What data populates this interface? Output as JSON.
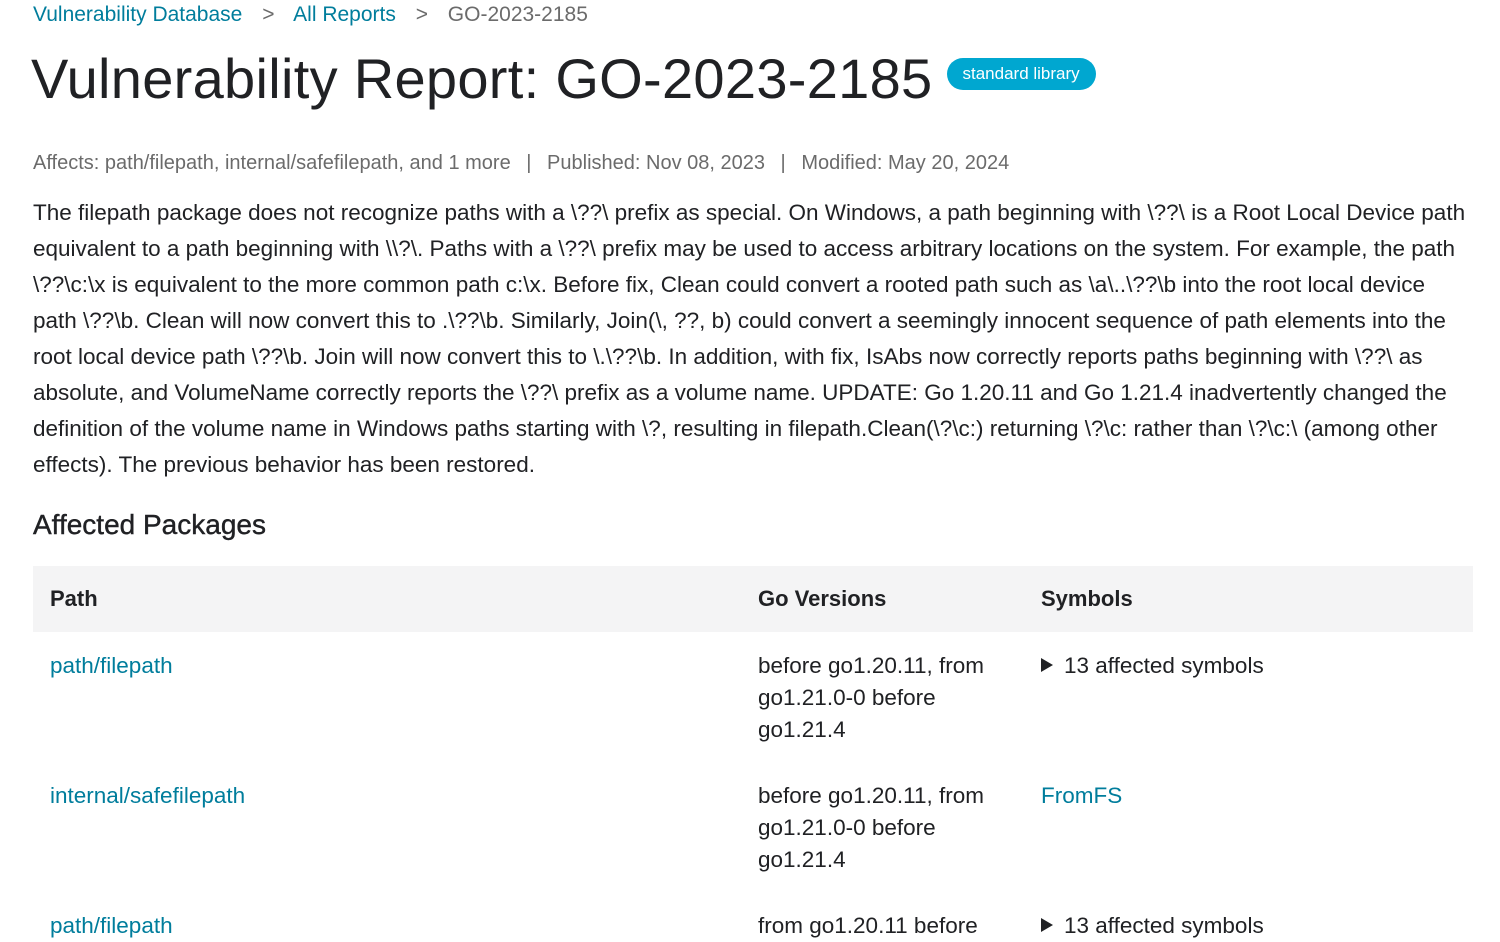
{
  "breadcrumb": {
    "items": [
      {
        "label": "Vulnerability Database"
      },
      {
        "label": "All Reports"
      }
    ],
    "separator": ">",
    "current": "GO-2023-2185"
  },
  "report": {
    "title": "Vulnerability Report: GO-2023-2185",
    "badge": "standard library",
    "affects": "Affects: path/filepath, internal/safefilepath, and 1 more",
    "published": "Published: Nov 08, 2023",
    "modified": "Modified: May 20, 2024",
    "meta_separator": "|",
    "description": "The filepath package does not recognize paths with a \\??\\ prefix as special. On Windows, a path beginning with \\??\\ is a Root Local Device path equivalent to a path beginning with \\\\?\\. Paths with a \\??\\ prefix may be used to access arbitrary locations on the system. For example, the path \\??\\c:\\x is equivalent to the more common path c:\\x. Before fix, Clean could convert a rooted path such as \\a\\..\\??\\b into the root local device path \\??\\b. Clean will now convert this to .\\??\\b. Similarly, Join(\\, ??, b) could convert a seemingly innocent sequence of path elements into the root local device path \\??\\b. Join will now convert this to \\.\\??\\b. In addition, with fix, IsAbs now correctly reports paths beginning with \\??\\ as absolute, and VolumeName correctly reports the \\??\\ prefix as a volume name. UPDATE: Go 1.20.11 and Go 1.21.4 inadvertently changed the definition of the volume name in Windows paths starting with \\?, resulting in filepath.Clean(\\?\\c:) returning \\?\\c: rather than \\?\\c:\\ (among other effects). The previous behavior has been restored."
  },
  "affected_packages": {
    "heading": "Affected Packages",
    "columns": {
      "path": "Path",
      "versions": "Go Versions",
      "symbols": "Symbols"
    },
    "rows": [
      {
        "path": "path/filepath",
        "versions": "before go1.20.11, from go1.21.0-0 before go1.21.4",
        "symbols": "13 affected symbols",
        "symbols_type": "disclosure"
      },
      {
        "path": "internal/safefilepath",
        "versions": "before go1.20.11, from go1.21.0-0 before go1.21.4",
        "symbols": "FromFS",
        "symbols_type": "link"
      },
      {
        "path": "path/filepath",
        "versions": "from go1.20.11 before",
        "symbols": "13 affected symbols",
        "symbols_type": "disclosure"
      }
    ]
  },
  "colors": {
    "link": "#007d9c",
    "badge": "#00a7d0",
    "muted": "#6b6b6b",
    "table_header_bg": "#f4f4f5"
  }
}
